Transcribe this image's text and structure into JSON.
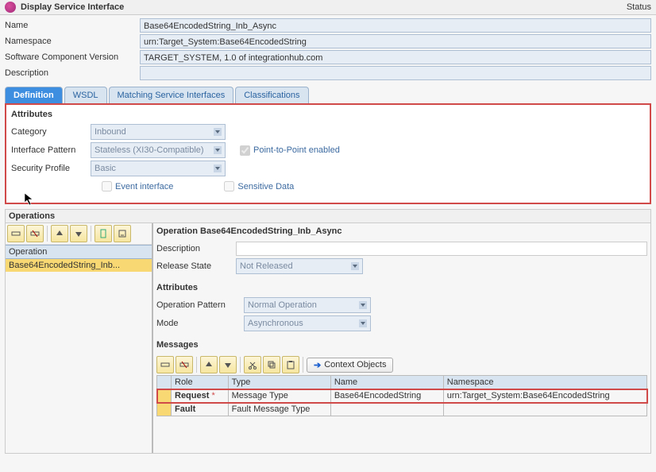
{
  "header": {
    "title": "Display Service Interface",
    "status": "Status"
  },
  "meta": {
    "name_label": "Name",
    "name_value": "Base64EncodedString_Inb_Async",
    "namespace_label": "Namespace",
    "namespace_value": "urn:Target_System:Base64EncodedString",
    "swcv_label": "Software Component Version",
    "swcv_value": "TARGET_SYSTEM, 1.0 of integrationhub.com",
    "description_label": "Description",
    "description_value": ""
  },
  "tabs": {
    "definition": "Definition",
    "wsdl": "WSDL",
    "matching": "Matching Service Interfaces",
    "classifications": "Classifications"
  },
  "attributes": {
    "section": "Attributes",
    "category_label": "Category",
    "category_value": "Inbound",
    "pattern_label": "Interface Pattern",
    "pattern_value": "Stateless (XI30-Compatible)",
    "p2p_label": "Point-to-Point enabled",
    "security_label": "Security Profile",
    "security_value": "Basic",
    "event_label": "Event interface",
    "sensitive_label": "Sensitive Data"
  },
  "operations": {
    "section": "Operations",
    "col_operation": "Operation",
    "item0": "Base64EncodedString_Inb...",
    "panel_title": "Operation Base64EncodedString_Inb_Async",
    "description_label": "Description",
    "release_label": "Release State",
    "release_value": "Not Released",
    "attr_section": "Attributes",
    "op_pattern_label": "Operation Pattern",
    "op_pattern_value": "Normal Operation",
    "mode_label": "Mode",
    "mode_value": "Asynchronous",
    "messages_section": "Messages",
    "context_btn": "Context Objects"
  },
  "messages_table": {
    "h_role": "Role",
    "h_type": "Type",
    "h_name": "Name",
    "h_namespace": "Namespace",
    "r1_role": "Request",
    "r1_star": "*",
    "r1_type": "Message Type",
    "r1_name": "Base64EncodedString",
    "r1_ns": "urn:Target_System:Base64EncodedString",
    "r2_role": "Fault",
    "r2_type": "Fault Message Type",
    "r2_name": "",
    "r2_ns": ""
  }
}
